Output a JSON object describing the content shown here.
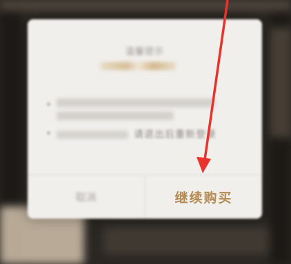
{
  "dialog": {
    "title": "温馨提示",
    "bullets": [
      {
        "text": ""
      },
      {
        "text": "请退出后重新登录"
      }
    ],
    "buttons": {
      "cancel": "取消",
      "continue": "继续购买"
    }
  },
  "colors": {
    "accent_gold": "#b58a52",
    "annotation_arrow": "#e8322b",
    "dialog_bg": "#f1efec",
    "backdrop": "#2a2622"
  },
  "annotation": {
    "type": "red-arrow",
    "points_to": "continue-purchase-button"
  }
}
